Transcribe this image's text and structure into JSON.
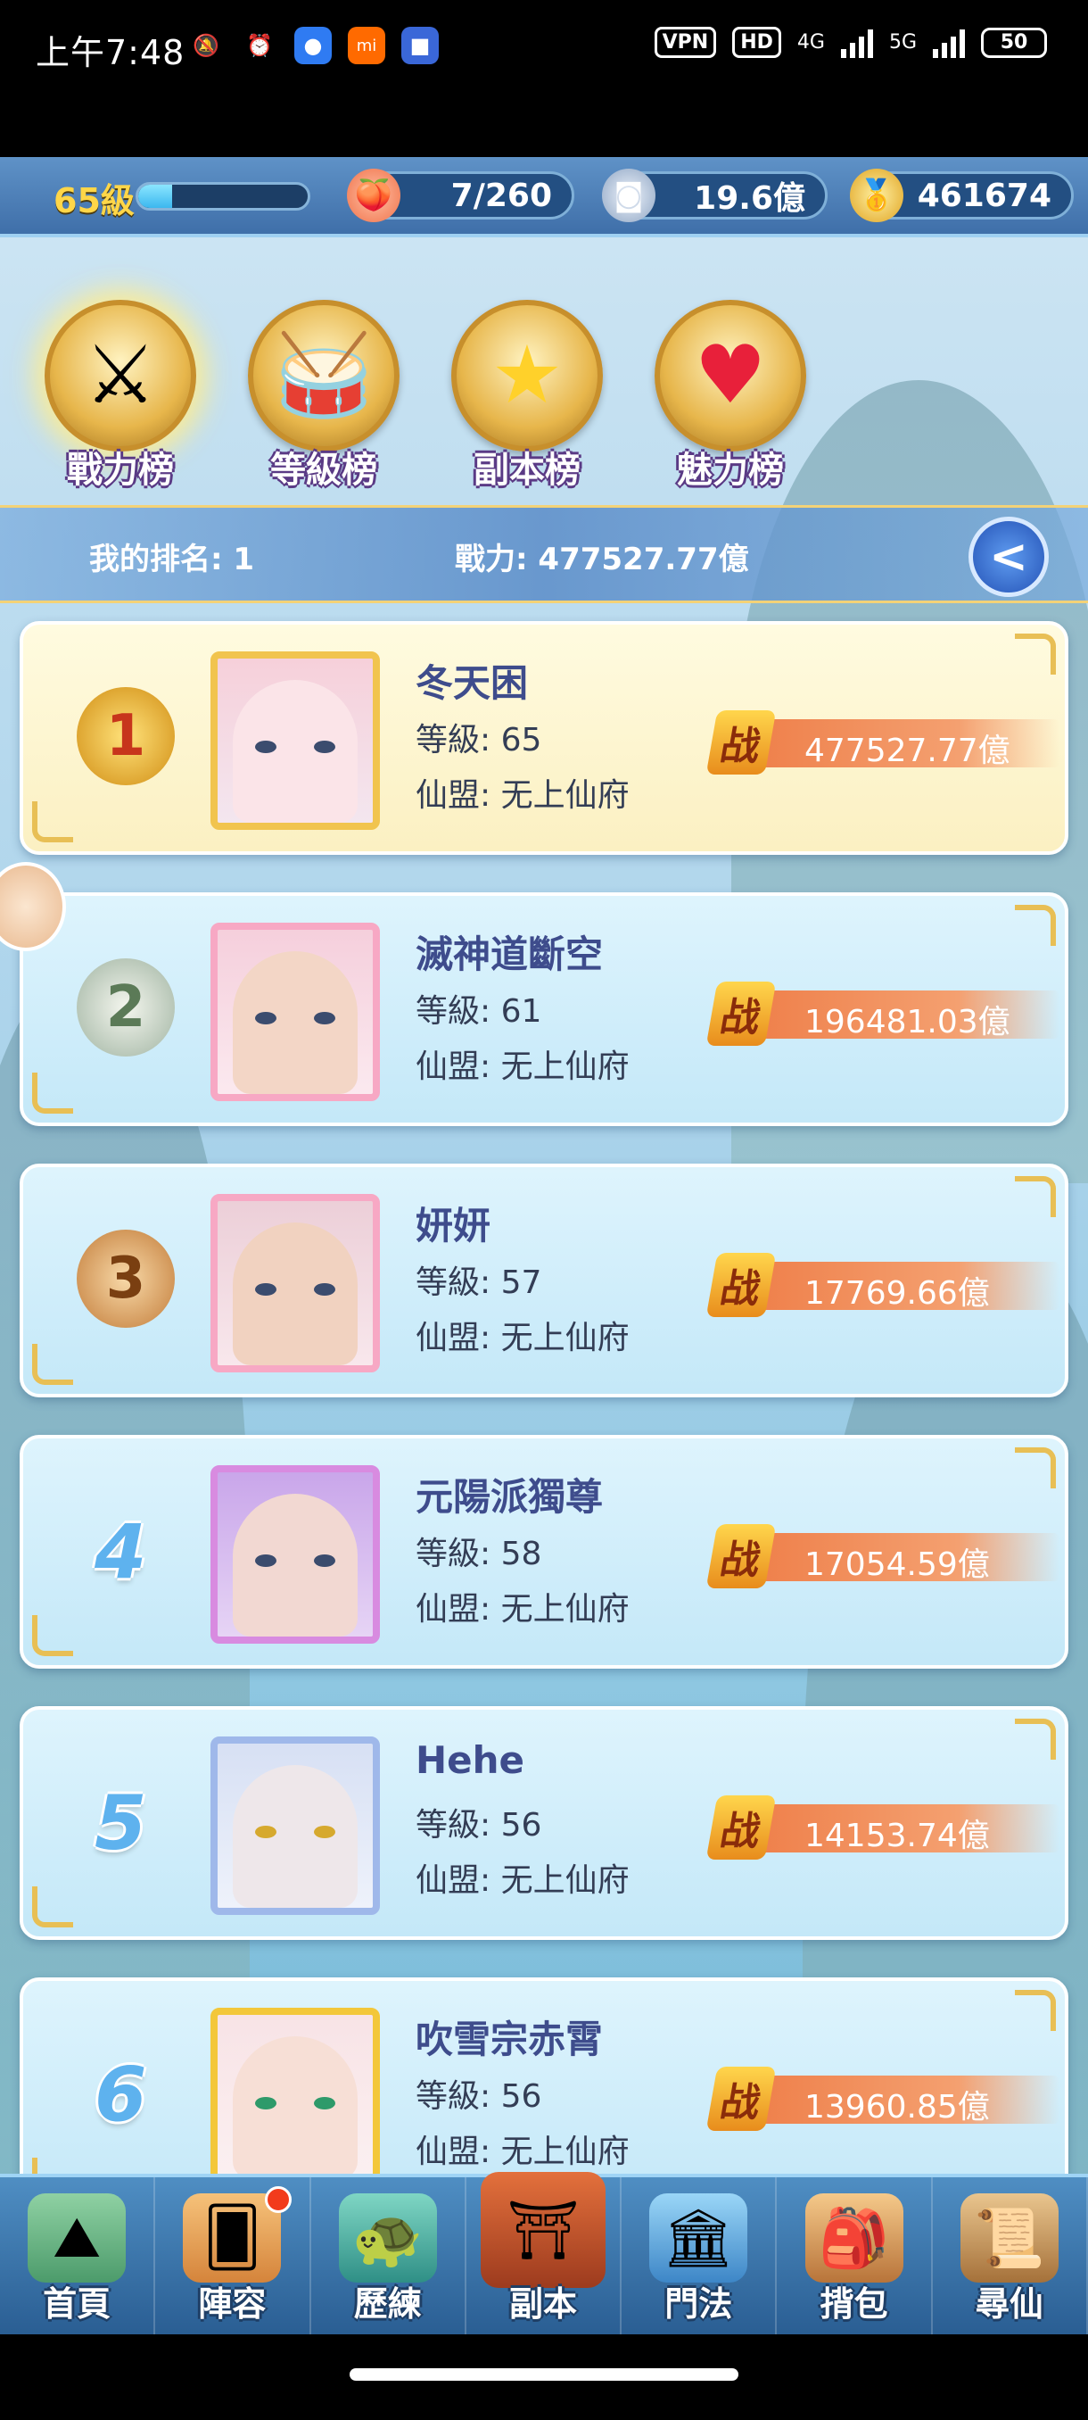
{
  "status_bar": {
    "time": "上午7:48",
    "vpn": "VPN",
    "hd": "HD",
    "net1": "4G",
    "net2": "5G",
    "battery": "50"
  },
  "resources": {
    "level": "65級",
    "xp_progress": 0.2,
    "stamina": "7/260",
    "silver": "19.6億",
    "gold": "461674"
  },
  "tabs": [
    {
      "label": "戰力榜",
      "icon": "sword-emblem-icon",
      "active": true
    },
    {
      "label": "等級榜",
      "icon": "drum-emblem-icon",
      "active": false
    },
    {
      "label": "副本榜",
      "icon": "star-emblem-icon",
      "active": false
    },
    {
      "label": "魅力榜",
      "icon": "heart-emblem-icon",
      "active": false
    }
  ],
  "my_rank": {
    "rank_text": "我的排名: 1",
    "power_text": "戰力: 477527.77億"
  },
  "power_icon_char": "战",
  "rankings": [
    {
      "rank": "1",
      "name": "冬天困",
      "level": "等級: 65",
      "guild": "仙盟: 无上仙府",
      "power": "477527.77億"
    },
    {
      "rank": "2",
      "name": "滅神道斷空",
      "level": "等級: 61",
      "guild": "仙盟: 无上仙府",
      "power": "196481.03億"
    },
    {
      "rank": "3",
      "name": "妍妍",
      "level": "等級: 57",
      "guild": "仙盟: 无上仙府",
      "power": "17769.66億"
    },
    {
      "rank": "4",
      "name": "元陽派獨尊",
      "level": "等級: 58",
      "guild": "仙盟: 无上仙府",
      "power": "17054.59億"
    },
    {
      "rank": "5",
      "name": "Hehe",
      "level": "等級: 56",
      "guild": "仙盟: 无上仙府",
      "power": "14153.74億"
    },
    {
      "rank": "6",
      "name": "吹雪宗赤霄",
      "level": "等級: 56",
      "guild": "仙盟: 无上仙府",
      "power": "13960.85億"
    }
  ],
  "nav": [
    {
      "label": "首頁",
      "icon": "home-island-icon",
      "badge": false
    },
    {
      "label": "陣容",
      "icon": "lineup-cards-icon",
      "badge": true
    },
    {
      "label": "歷練",
      "icon": "training-turtle-icon",
      "badge": false
    },
    {
      "label": "副本",
      "icon": "dungeon-gate-icon",
      "badge": false
    },
    {
      "label": "門法",
      "icon": "sect-altar-icon",
      "badge": false
    },
    {
      "label": "揹包",
      "icon": "backpack-icon",
      "badge": false
    },
    {
      "label": "尋仙",
      "icon": "scroll-search-icon",
      "badge": false
    }
  ],
  "colors": {
    "accent_gold": "#f1c44e",
    "name_blue": "#3e4c8c",
    "power_orange": "#ee7b45",
    "nav_blue": "#2a5e93"
  }
}
